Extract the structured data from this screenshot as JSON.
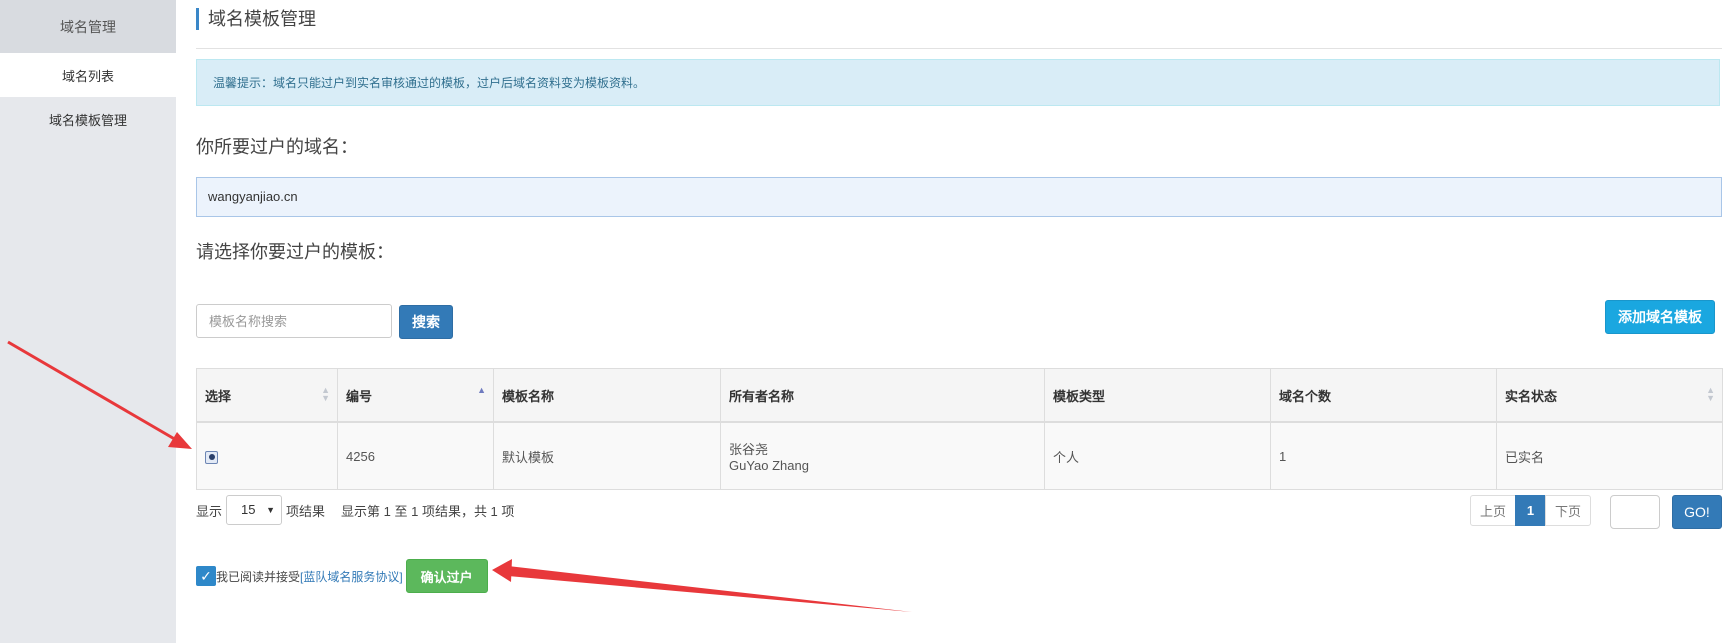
{
  "sidebar": {
    "group_label": "域名管理",
    "items": [
      {
        "label": "域名列表",
        "active": true
      },
      {
        "label": "域名模板管理",
        "active": false
      }
    ]
  },
  "page": {
    "title": "域名模板管理",
    "alert": "温馨提示：域名只能过户到实名审核通过的模板，过户后域名资料变为模板资料。",
    "domain_label": "你所要过户的域名：",
    "domain_value": "wangyanjiao.cn",
    "template_label": "请选择你要过户的模板："
  },
  "search": {
    "placeholder": "模板名称搜索",
    "button_label": "搜索",
    "add_button_label": "添加域名模板"
  },
  "table": {
    "columns": [
      "选择",
      "编号",
      "模板名称",
      "所有者名称",
      "模板类型",
      "域名个数",
      "实名状态"
    ],
    "rows": [
      {
        "selected": true,
        "id": "4256",
        "name": "默认模板",
        "owner_cn": "张谷尧",
        "owner_en": "GuYao Zhang",
        "type": "个人",
        "domain_count": "1",
        "status": "已实名"
      }
    ]
  },
  "pagination": {
    "show_label": "显示",
    "page_length": "15",
    "results_suffix": "项结果",
    "info": "显示第 1 至 1 项结果，共 1 项",
    "prev": "上页",
    "current": "1",
    "next": "下页",
    "go_label": "GO!"
  },
  "agreement": {
    "checked": true,
    "text": "我已阅读并接受",
    "link": "[蓝队域名服务协议]",
    "confirm_label": "确认过户"
  },
  "annotation_color": "#e8383b"
}
